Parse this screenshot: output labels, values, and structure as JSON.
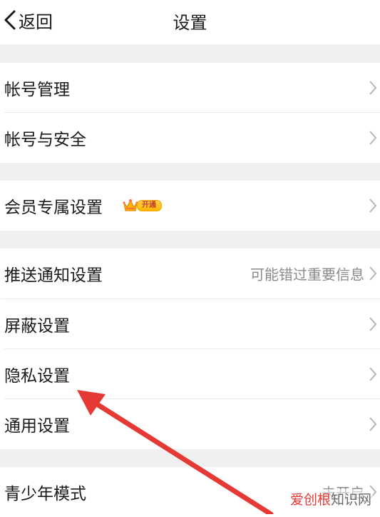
{
  "header": {
    "back_label": "返回",
    "title": "设置"
  },
  "sections": [
    {
      "items": [
        {
          "label": "帐号管理"
        },
        {
          "label": "帐号与安全"
        }
      ]
    },
    {
      "items": [
        {
          "label": "会员专属设置",
          "badge": "开通"
        }
      ]
    },
    {
      "items": [
        {
          "label": "推送通知设置",
          "value": "可能错过重要信息"
        },
        {
          "label": "屏蔽设置"
        },
        {
          "label": "隐私设置"
        },
        {
          "label": "通用设置"
        }
      ]
    },
    {
      "items": [
        {
          "label": "青少年模式",
          "value": "未开启"
        }
      ]
    }
  ],
  "watermark": {
    "brand": "爱创根",
    "suffix": "知识网"
  },
  "colors": {
    "background": "#f0f0f0",
    "row": "#ffffff",
    "annotation_arrow": "#e53935"
  },
  "icons": [
    "chevron-left-icon",
    "chevron-right-icon",
    "crown-icon"
  ]
}
